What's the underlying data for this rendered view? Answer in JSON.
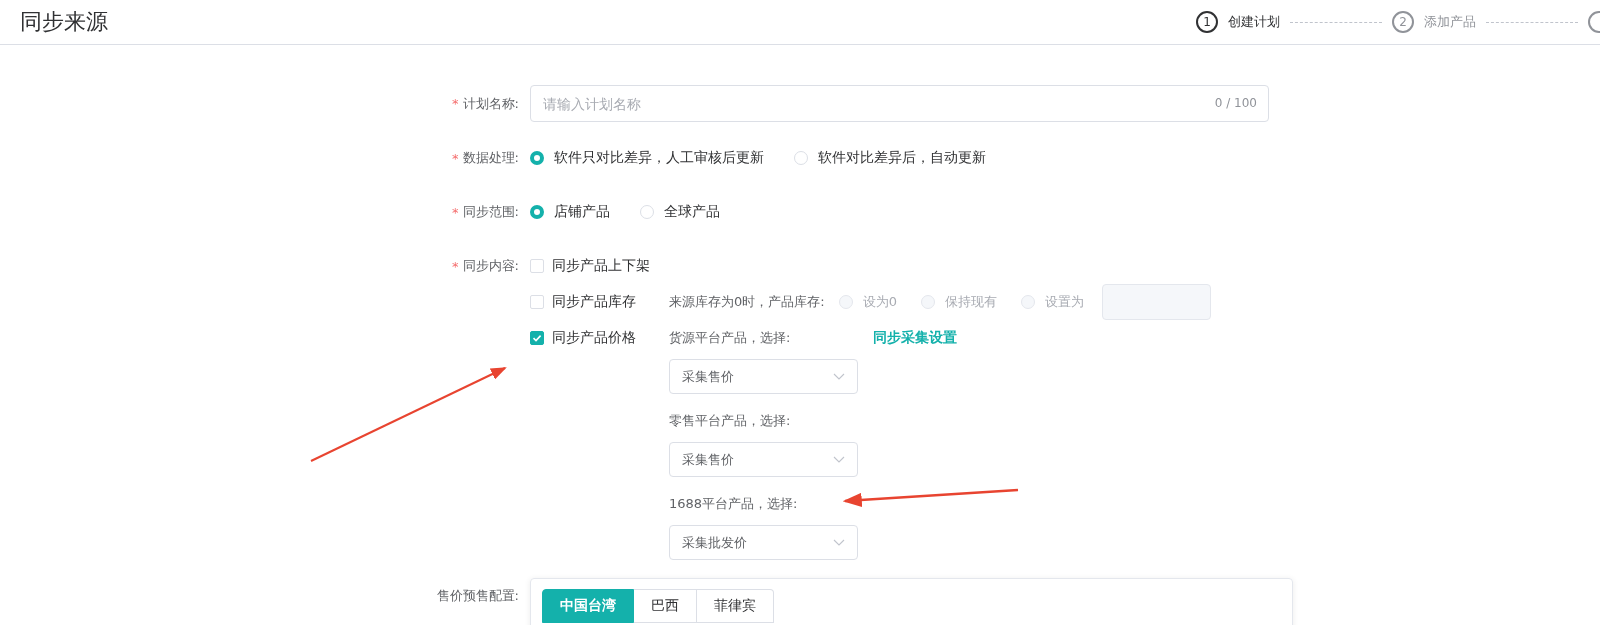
{
  "header": {
    "title": "同步来源"
  },
  "steps": [
    {
      "number": "1",
      "label": "创建计划",
      "selected": true
    },
    {
      "number": "2",
      "label": "添加产品",
      "selected": false
    },
    {
      "selected": false
    }
  ],
  "plan_name": {
    "label": "计划名称:",
    "required_mark": "*",
    "placeholder": "请输入计划名称",
    "counter": "0 / 100"
  },
  "data_processing": {
    "label": "数据处理:",
    "required_mark": "*",
    "options": [
      {
        "label": "软件只对比差异，人工审核后更新",
        "selected": true
      },
      {
        "label": "软件对比差异后，自动更新",
        "selected": false
      }
    ]
  },
  "sync_scope": {
    "label": "同步范围:",
    "required_mark": "*",
    "options": [
      {
        "label": "店铺产品",
        "selected": true
      },
      {
        "label": "全球产品",
        "selected": false
      }
    ]
  },
  "sync_content": {
    "label": "同步内容:",
    "required_mark": "*",
    "items": [
      {
        "kind": "plain",
        "label": "同步产品上下架",
        "checked": false
      },
      {
        "kind": "stock",
        "label": "同步产品库存",
        "checked": false,
        "prompt": "来源库存为0时，产品库存:",
        "options": [
          {
            "label": "设为0",
            "selected": false,
            "disabled": true
          },
          {
            "label": "保持现有",
            "selected": false,
            "disabled": true
          },
          {
            "kind": "with_field",
            "label": "设置为",
            "selected": false,
            "disabled": true
          }
        ]
      },
      {
        "kind": "price",
        "label": "同步产品价格",
        "checked": true,
        "link": "同步采集设置",
        "sources": [
          {
            "label": "货源平台产品，选择:",
            "value": "采集售价"
          },
          {
            "label": "零售平台产品，选择:",
            "value": "采集售价"
          },
          {
            "label": "1688平台产品，选择:",
            "value": "采集批发价"
          }
        ]
      }
    ]
  },
  "presale": {
    "label": "售价预售配置:",
    "tabs": [
      {
        "label": "中国台湾",
        "selected": true
      },
      {
        "label": "巴西",
        "selected": false
      },
      {
        "label": "菲律宾",
        "selected": false
      }
    ]
  }
}
